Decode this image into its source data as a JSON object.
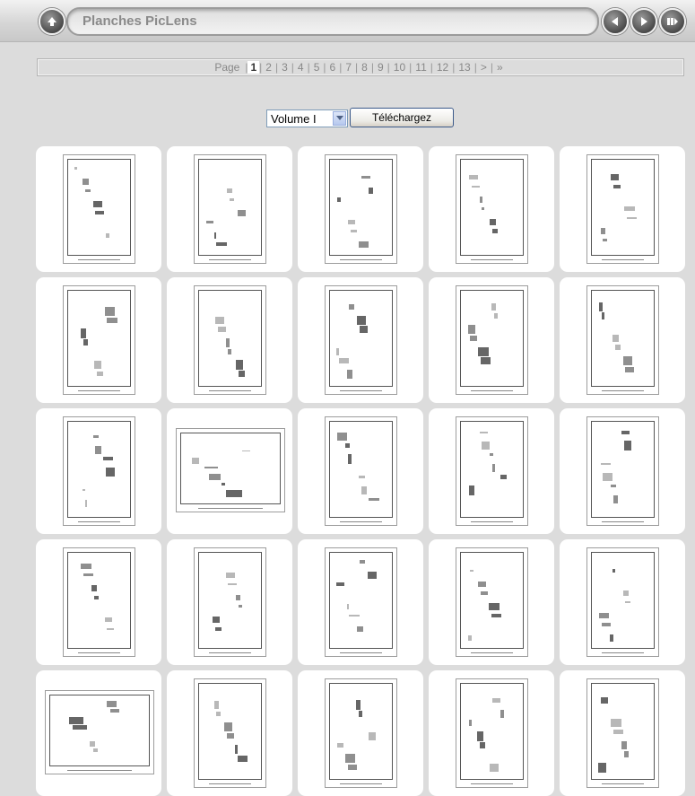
{
  "header": {
    "title": "Planches PicLens",
    "buttons": [
      "home-icon",
      "previous-icon",
      "next-icon",
      "slideshow-icon"
    ]
  },
  "pagination": {
    "label": "Page",
    "current": "1",
    "pages": [
      "1",
      "2",
      "3",
      "4",
      "5",
      "6",
      "7",
      "8",
      "9",
      "10",
      "11",
      "12",
      "13"
    ],
    "next": ">",
    "last": "»"
  },
  "volume": {
    "selected": "Volume I",
    "download_label": "Téléchargez"
  },
  "colors": {
    "background": "#dcdcdc",
    "card": "#ffffff",
    "title_text": "#8a8a8a"
  }
}
